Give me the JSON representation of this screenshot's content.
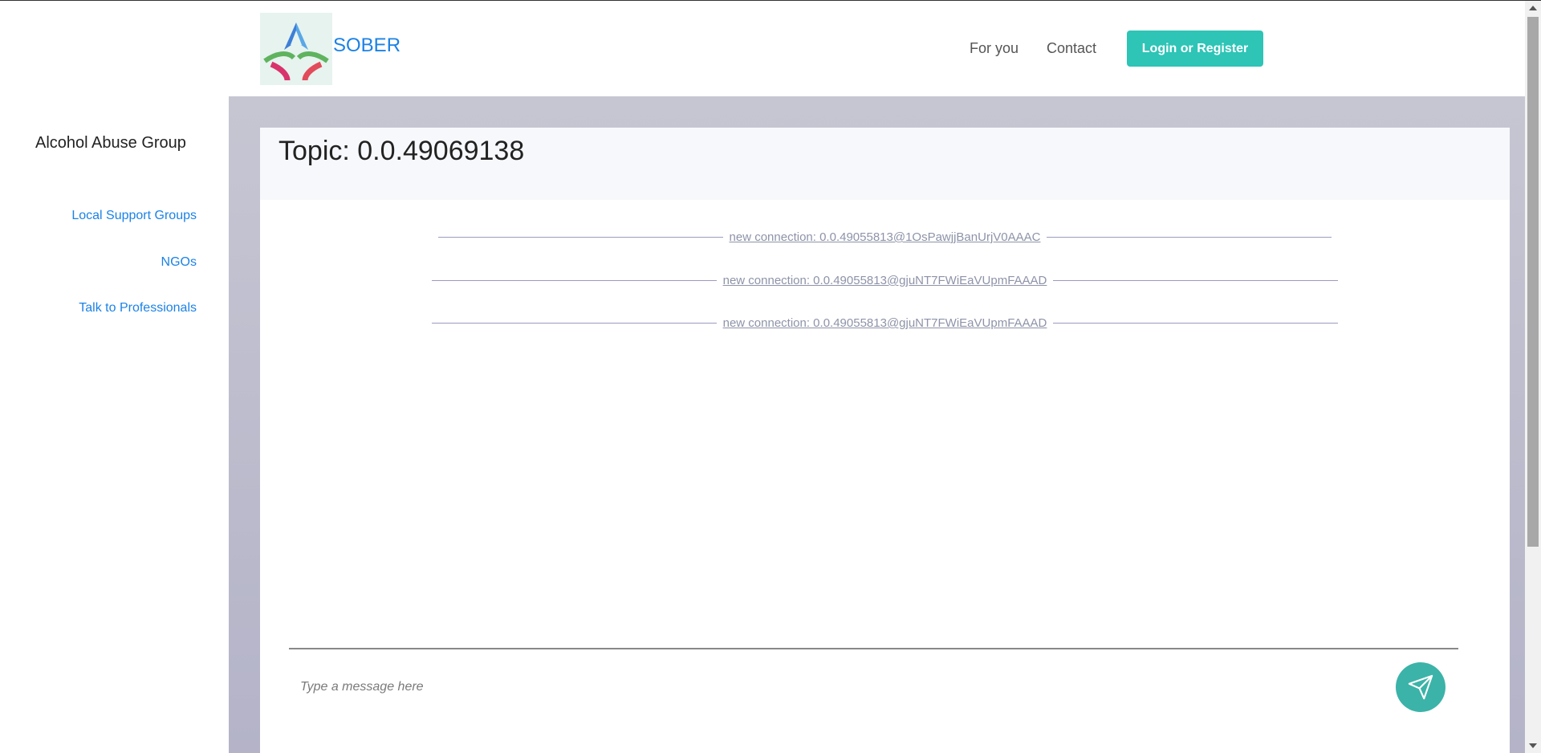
{
  "header": {
    "brand": "SOBER",
    "nav": [
      "For you",
      "Contact"
    ],
    "login_label": "Login or Register"
  },
  "sidebar": {
    "title": "Alcohol Abuse Group",
    "links": [
      "Local Support Groups",
      "NGOs",
      "Talk to Professionals"
    ]
  },
  "chat": {
    "topic": "Topic: 0.0.49069138",
    "messages": [
      "new connection: 0.0.49055813@1OsPawjjBanUrjV0AAAC",
      "new connection: 0.0.49055813@gjuNT7FWiEaVUpmFAAAD",
      "new connection: 0.0.49055813@gjuNT7FWiEaVUpmFAAAD"
    ],
    "input_placeholder": "Type a message here"
  },
  "colors": {
    "accent": "#2ec4b6",
    "link": "#1b82e6",
    "send": "#3bb3a8"
  },
  "icons": {
    "send": "paper-plane-icon"
  }
}
